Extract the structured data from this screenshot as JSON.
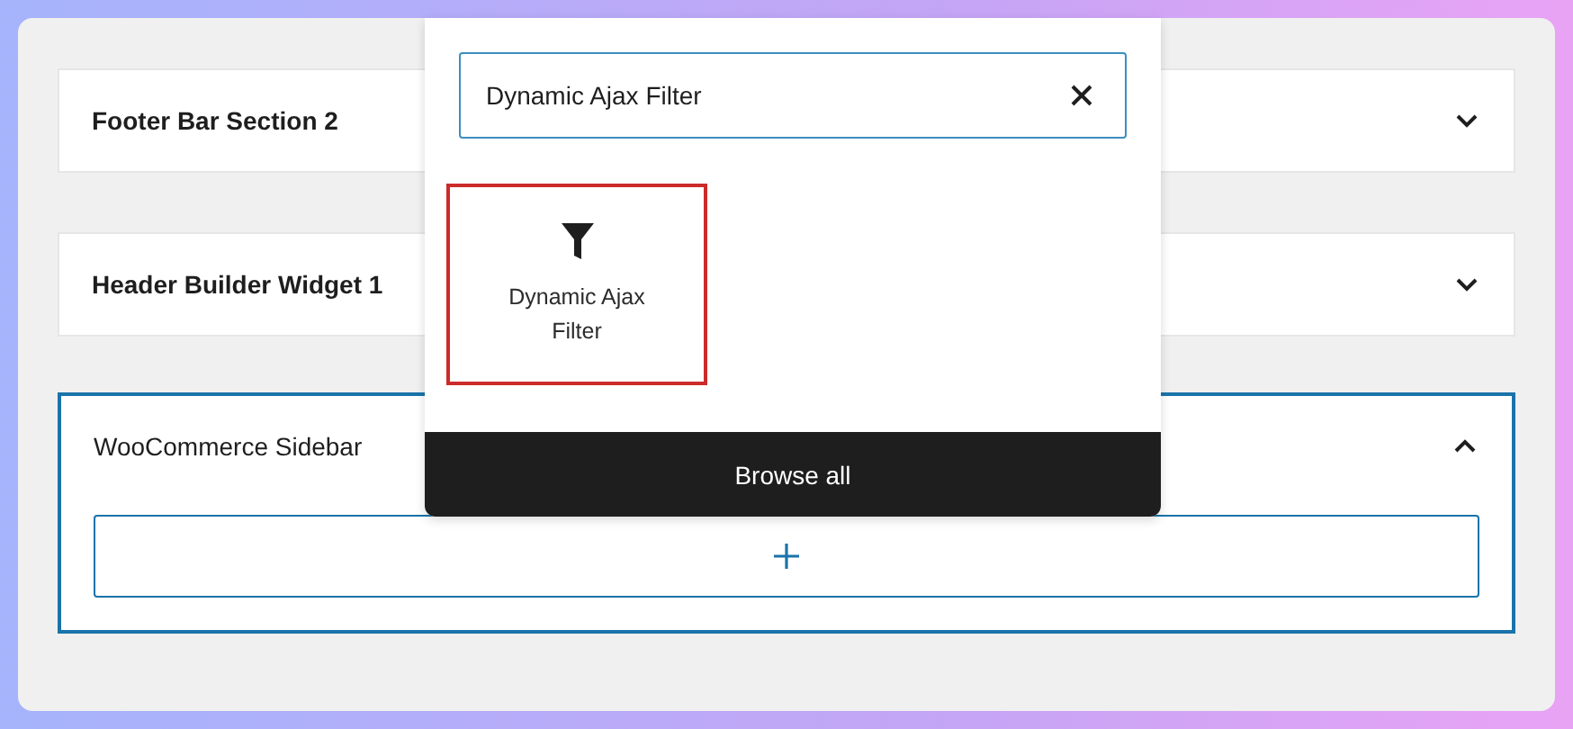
{
  "sections": [
    {
      "title": "Footer Bar Section 2",
      "expanded": false
    },
    {
      "title": "Header Builder Widget 1",
      "expanded": false
    },
    {
      "title": "WooCommerce Sidebar",
      "expanded": true
    }
  ],
  "inserter": {
    "search": {
      "value": "Dynamic Ajax Filter"
    },
    "results": [
      {
        "label": "Dynamic Ajax Filter",
        "selected": true
      }
    ],
    "browse_button": "Browse all"
  }
}
